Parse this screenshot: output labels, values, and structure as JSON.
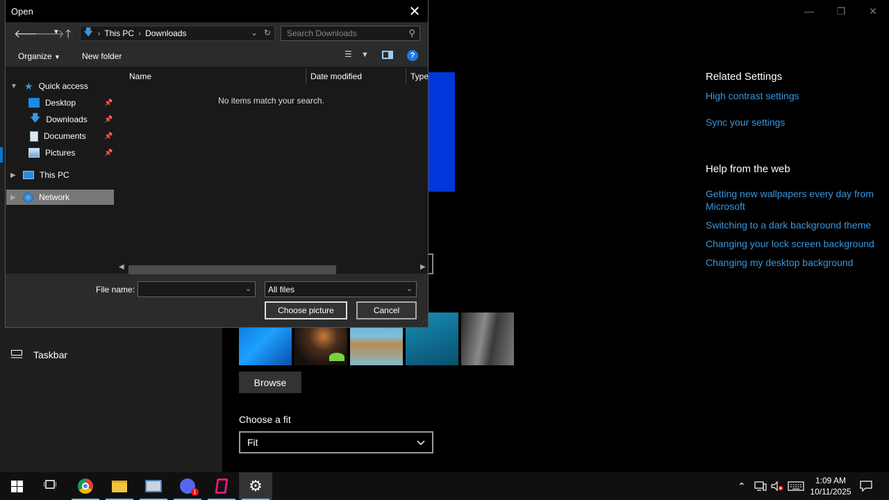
{
  "settings": {
    "sidebar_taskbar_label": "Taskbar",
    "browse_label": "Browse",
    "fit_label": "Choose a fit",
    "fit_value": "Fit",
    "related_title": "Related Settings",
    "related_links": [
      "High contrast settings",
      "Sync your settings"
    ],
    "help_title": "Help from the web",
    "help_links": [
      "Getting new wallpapers every day from Microsoft",
      "Switching to a dark background theme",
      "Changing your lock screen background",
      "Changing my desktop background"
    ]
  },
  "dialog": {
    "title": "Open",
    "breadcrumbs": [
      "This PC",
      "Downloads"
    ],
    "search_placeholder": "Search Downloads",
    "organize_label": "Organize",
    "new_folder_label": "New folder",
    "nav": {
      "quick_access": "Quick access",
      "desktop": "Desktop",
      "downloads": "Downloads",
      "documents": "Documents",
      "pictures": "Pictures",
      "this_pc": "This PC",
      "network": "Network"
    },
    "columns": [
      "Name",
      "Date modified",
      "Type"
    ],
    "empty_message": "No items match your search.",
    "file_name_label": "File name:",
    "file_name_value": "",
    "filter_value": "All files",
    "choose_label": "Choose picture",
    "cancel_label": "Cancel"
  },
  "taskbar": {
    "time": "1:09 AM",
    "date": "10/11/2025",
    "discord_badge": "1"
  },
  "colors": {
    "accent": "#0078d7",
    "link": "#3a96dd"
  }
}
